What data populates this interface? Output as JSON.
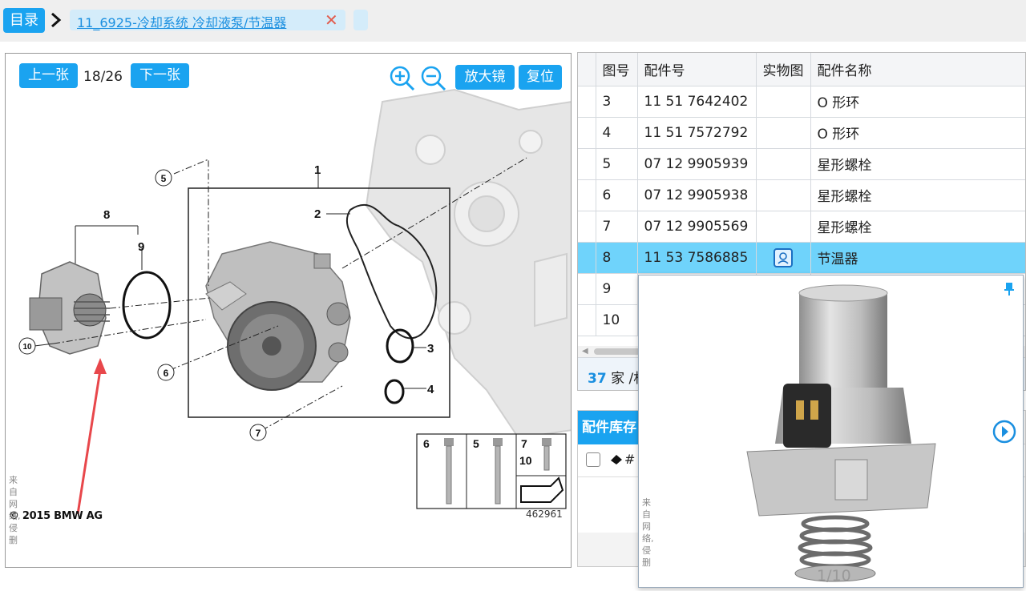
{
  "topbar": {
    "catalog_label": "目录",
    "tab_label": "11_6925-冷却系统 冷却液泵/节温器",
    "tab_close": "✕"
  },
  "viewer": {
    "prev_label": "上一张",
    "page": "18/26",
    "next_label": "下一张",
    "magnifier_label": "放大镜",
    "reset_label": "复位",
    "copyright": "© 2015 BMW AG",
    "drawing_number": "462961",
    "watermark": "来自网络,侵删",
    "callouts": [
      "1",
      "2",
      "3",
      "4",
      "5",
      "6",
      "7",
      "8",
      "9",
      "10"
    ],
    "legend_callouts": [
      "6",
      "5",
      "7",
      "10"
    ]
  },
  "parts_table": {
    "columns": [
      "图号",
      "配件号",
      "实物图",
      "配件名称"
    ],
    "rows": [
      {
        "no": "3",
        "part_no": "11 51 7642402",
        "name": "O 形环",
        "has_photo": false
      },
      {
        "no": "4",
        "part_no": "11 51 7572792",
        "name": "O 形环",
        "has_photo": false
      },
      {
        "no": "5",
        "part_no": "07 12 9905939",
        "name": "星形螺栓",
        "has_photo": false
      },
      {
        "no": "6",
        "part_no": "07 12 9905938",
        "name": "星形螺栓",
        "has_photo": false
      },
      {
        "no": "7",
        "part_no": "07 12 9905569",
        "name": "星形螺栓",
        "has_photo": false
      },
      {
        "no": "8",
        "part_no": "11 53 7586885",
        "name": "节温器",
        "has_photo": true,
        "selected": true
      },
      {
        "no": "9",
        "part_no": "",
        "name": "",
        "has_photo": false
      },
      {
        "no": "10",
        "part_no": "",
        "name": "",
        "has_photo": false
      }
    ],
    "footer_count": "37",
    "footer_unit": "家 /",
    "footer_suffix": "村"
  },
  "stock": {
    "title": "配件库存",
    "hash_label": "#"
  },
  "photo_popup": {
    "counter": "1/10",
    "watermark": "来自网络,侵删"
  },
  "colors": {
    "accent": "#1aa3f0",
    "selected_row": "#6fd3fb",
    "tab_bg": "#d4ecfa",
    "close_red": "#e25b4c",
    "arrow_red": "#e8474b"
  },
  "icons": [
    "chevron-right-icon",
    "close-icon",
    "zoom-in-icon",
    "zoom-out-icon",
    "photo-icon",
    "pin-icon",
    "next-image-icon",
    "eraser-icon"
  ]
}
